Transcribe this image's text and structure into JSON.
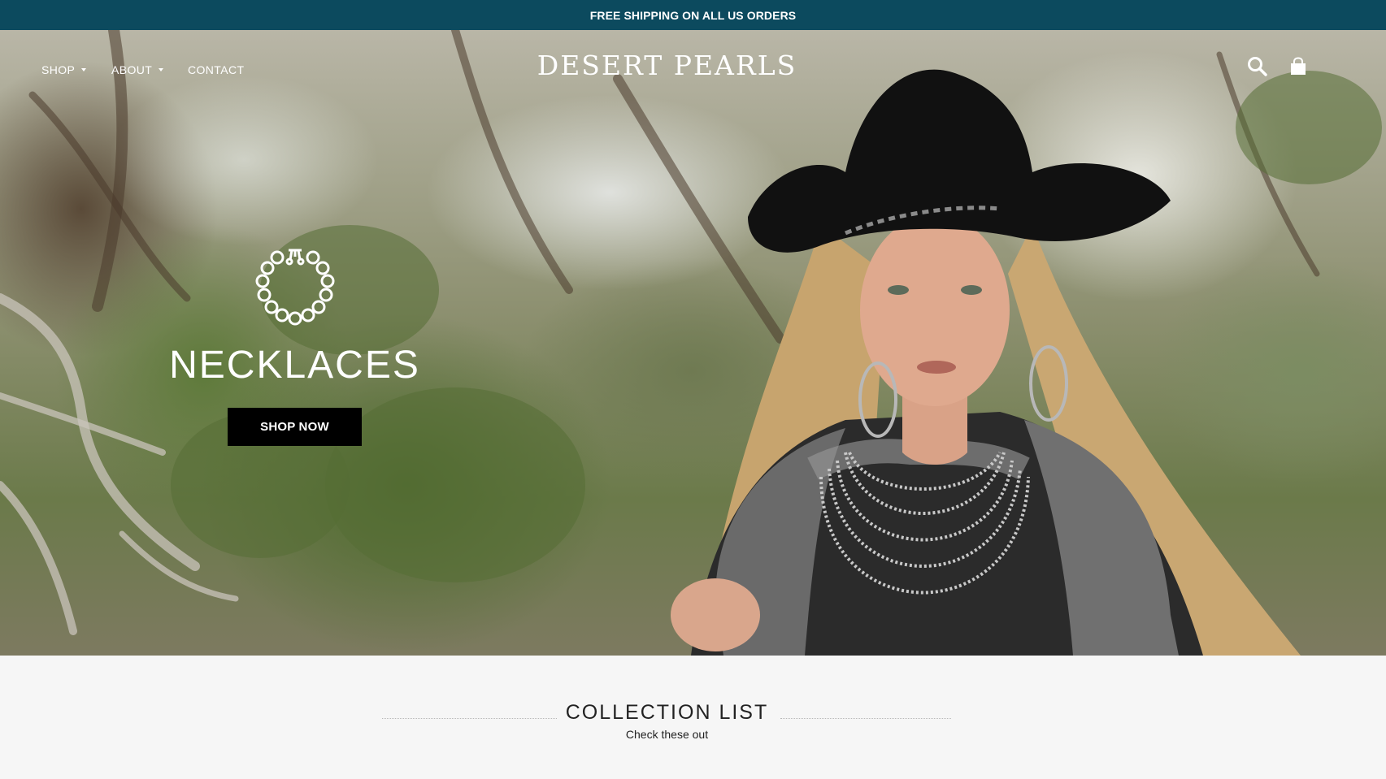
{
  "announcement": {
    "text": "FREE SHIPPING ON ALL US ORDERS",
    "background": "#0c4a5e"
  },
  "header": {
    "nav": [
      {
        "label": "SHOP",
        "has_dropdown": true
      },
      {
        "label": "ABOUT",
        "has_dropdown": true
      },
      {
        "label": "CONTACT",
        "has_dropdown": false
      }
    ],
    "logo": "DESERT PEARLS",
    "icons": [
      "search-icon",
      "shopping-bag-icon"
    ]
  },
  "hero": {
    "icon": "pearl-necklace-icon",
    "title": "NECKLACES",
    "button_label": "SHOP NOW",
    "image": "woman-in-black-cowboy-hat-with-fur-collar-and-pearl-necklaces"
  },
  "collection": {
    "heading": "COLLECTION LIST",
    "subheading": "Check these out"
  }
}
